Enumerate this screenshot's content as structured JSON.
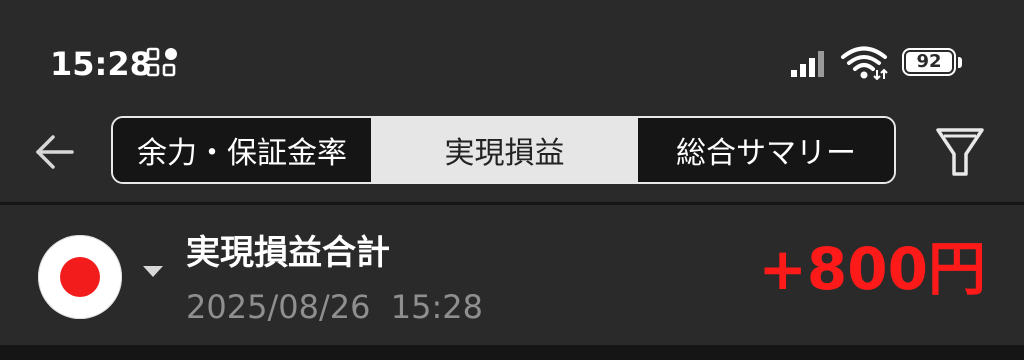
{
  "status_bar": {
    "time": "15:28",
    "battery_level": "92",
    "icons": [
      "app-grid-icon",
      "signal-icon",
      "wifi-icon",
      "battery-icon"
    ]
  },
  "toolbar": {
    "tabs": [
      {
        "label": "余力・保証金率",
        "active": false
      },
      {
        "label": "実現損益",
        "active": true
      },
      {
        "label": "総合サマリー",
        "active": false
      }
    ],
    "icons": [
      "back-arrow-icon",
      "filter-icon"
    ]
  },
  "summary": {
    "title": "実現損益合計",
    "timestamp": "2025/08/26  15:28",
    "value": "+800円",
    "value_color": "#ff1a1a",
    "flag": "japan-flag-icon"
  },
  "colors": {
    "background": "#2a2a2a",
    "dark_band": "#151515",
    "active_tab": "#e6e6e6",
    "timestamp_gray": "#8f8f8f"
  }
}
